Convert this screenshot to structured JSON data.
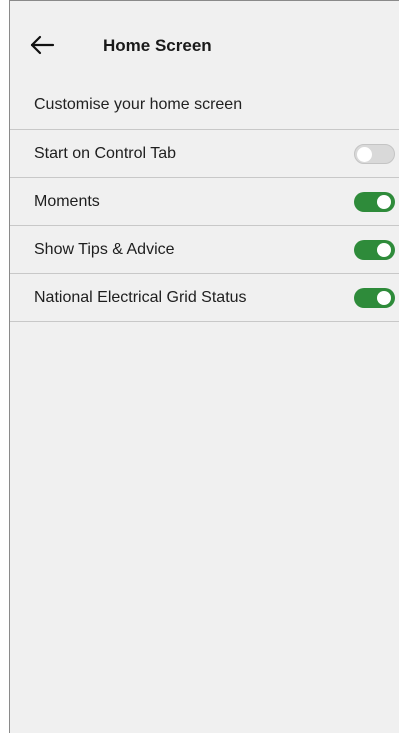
{
  "header": {
    "title": "Home Screen",
    "back_icon": "arrow-left-icon"
  },
  "section": {
    "label": "Customise your home screen"
  },
  "settings": [
    {
      "label": "Start on Control Tab",
      "enabled": false
    },
    {
      "label": "Moments",
      "enabled": true
    },
    {
      "label": "Show Tips & Advice",
      "enabled": true
    },
    {
      "label": "National Electrical Grid Status",
      "enabled": true
    }
  ],
  "colors": {
    "toggle_on": "#2e8b3a",
    "toggle_off": "#d9d9d9",
    "background": "#f0f0f0"
  }
}
